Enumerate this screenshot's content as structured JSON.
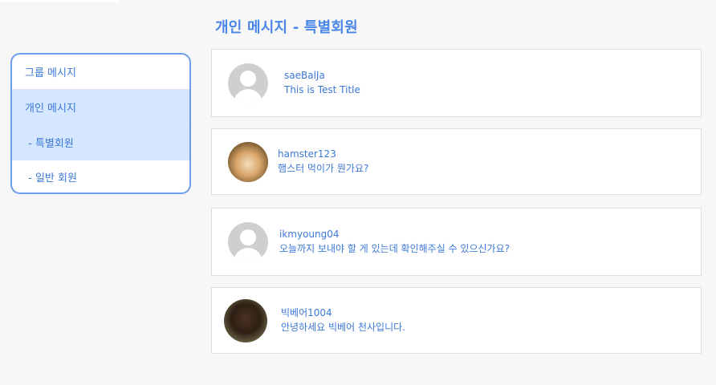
{
  "page_title": "개인 메시지 - 특별회원",
  "sidebar": {
    "items": [
      {
        "label": "그룹 메시지"
      },
      {
        "label": "개인 메시지"
      },
      {
        "label": " - 특별회원"
      },
      {
        "label": " - 일반 회원"
      }
    ]
  },
  "messages": [
    {
      "username": "saeBalJa",
      "text": "This is Test Title",
      "avatar": "default-avatar"
    },
    {
      "username": "hamster123",
      "text": "햄스터 먹이가 뭔가요?",
      "avatar": "hamster-photo"
    },
    {
      "username": "ikmyoung04",
      "text": "오늘까지 보내야 할 게 있는데 확인해주실 수 있으신가요?",
      "avatar": "default-avatar"
    },
    {
      "username": "빅베어1004",
      "text": "안녕하세요 빅베어 천사입니다.",
      "avatar": "bear-photo"
    }
  ],
  "colors": {
    "accent": "#4a86e8",
    "active_bg": "#d5e6ff",
    "page_bg": "#f7f7f7"
  }
}
